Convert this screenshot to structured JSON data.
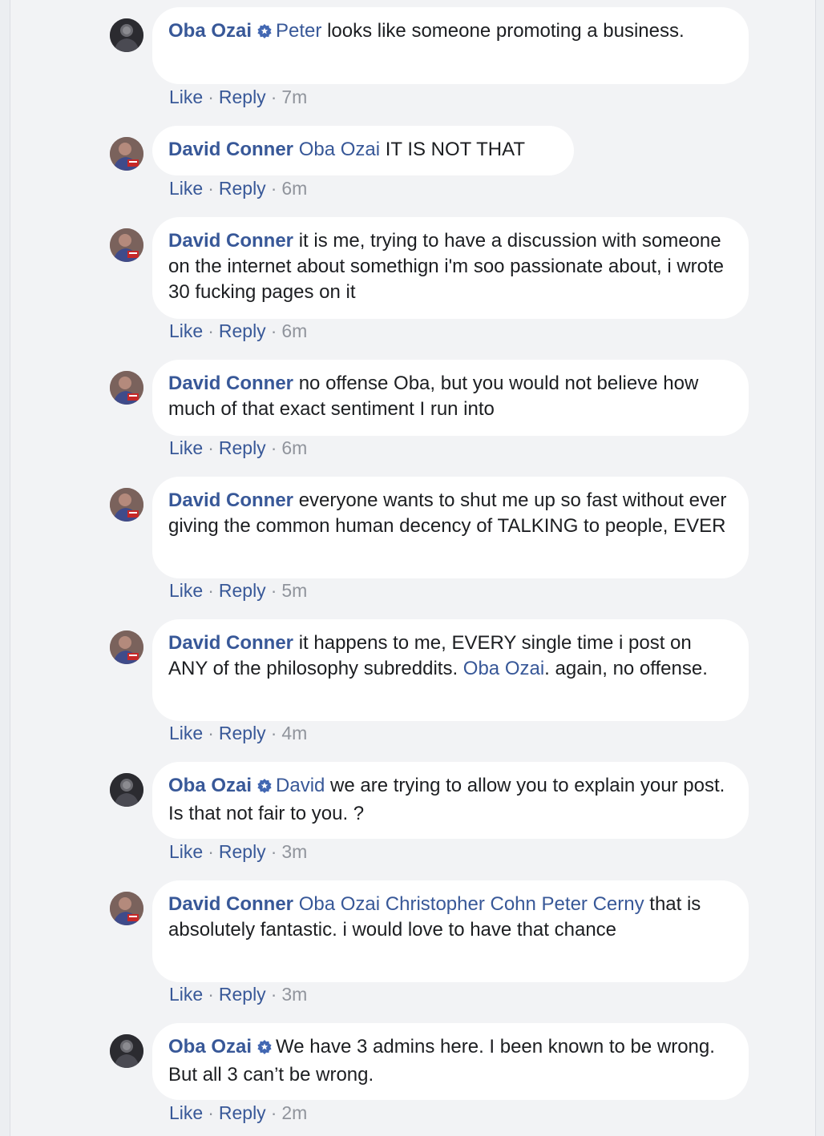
{
  "labels": {
    "like": "Like",
    "reply": "Reply",
    "dot": "·"
  },
  "colors": {
    "link": "#385898",
    "meta": "#90949c",
    "bubble": "#ffffff",
    "background": "#f2f3f5"
  },
  "icons": {
    "verified": "verified-badge-icon"
  },
  "comments": [
    {
      "author": "Oba Ozai",
      "verified": true,
      "avatar": "avatar-oba-ozai",
      "mentions": [
        "Peter"
      ],
      "text": " looks like someone promoting a business.",
      "time": "7m"
    },
    {
      "author": "David Conner",
      "verified": false,
      "avatar": "avatar-david-conner",
      "mentions": [
        "Oba Ozai"
      ],
      "text": " IT IS NOT THAT",
      "time": "6m"
    },
    {
      "author": "David Conner",
      "verified": false,
      "avatar": "avatar-david-conner",
      "text": " it is me, trying to have a discussion with someone on the internet about somethign i'm soo passionate about, i wrote 30 fucking pages on it",
      "time": "6m"
    },
    {
      "author": "David Conner",
      "verified": false,
      "avatar": "avatar-david-conner",
      "text": " no offense Oba, but you would not believe how much of that exact sentiment I run into",
      "time": "6m"
    },
    {
      "author": "David Conner",
      "verified": false,
      "avatar": "avatar-david-conner",
      "text": " everyone wants to shut me up so fast without ever giving the common human decency of TALKING to people, EVER",
      "time": "5m"
    },
    {
      "author": "David Conner",
      "verified": false,
      "avatar": "avatar-david-conner",
      "text": " it happens to me, EVERY single time i post on ANY of the philosophy subreddits. ",
      "mentions": [
        "Oba Ozai"
      ],
      "text_after": ". again, no offense.",
      "time": "4m"
    },
    {
      "author": "Oba Ozai",
      "verified": true,
      "avatar": "avatar-oba-ozai",
      "mentions": [
        "David"
      ],
      "text": " we are trying to allow you to explain your post. Is that not fair to you. ?",
      "time": "3m"
    },
    {
      "author": "David Conner",
      "verified": false,
      "avatar": "avatar-david-conner",
      "mentions": [
        "Oba Ozai",
        "Christopher Cohn",
        "Peter Cerny"
      ],
      "text": " that is absolutely fantastic. i would love to have that chance",
      "time": "3m"
    },
    {
      "author": "Oba Ozai",
      "verified": true,
      "avatar": "avatar-oba-ozai",
      "text": "We have 3 admins here. I been known to be wrong. But all 3 can’t be wrong.",
      "time": "2m"
    }
  ]
}
